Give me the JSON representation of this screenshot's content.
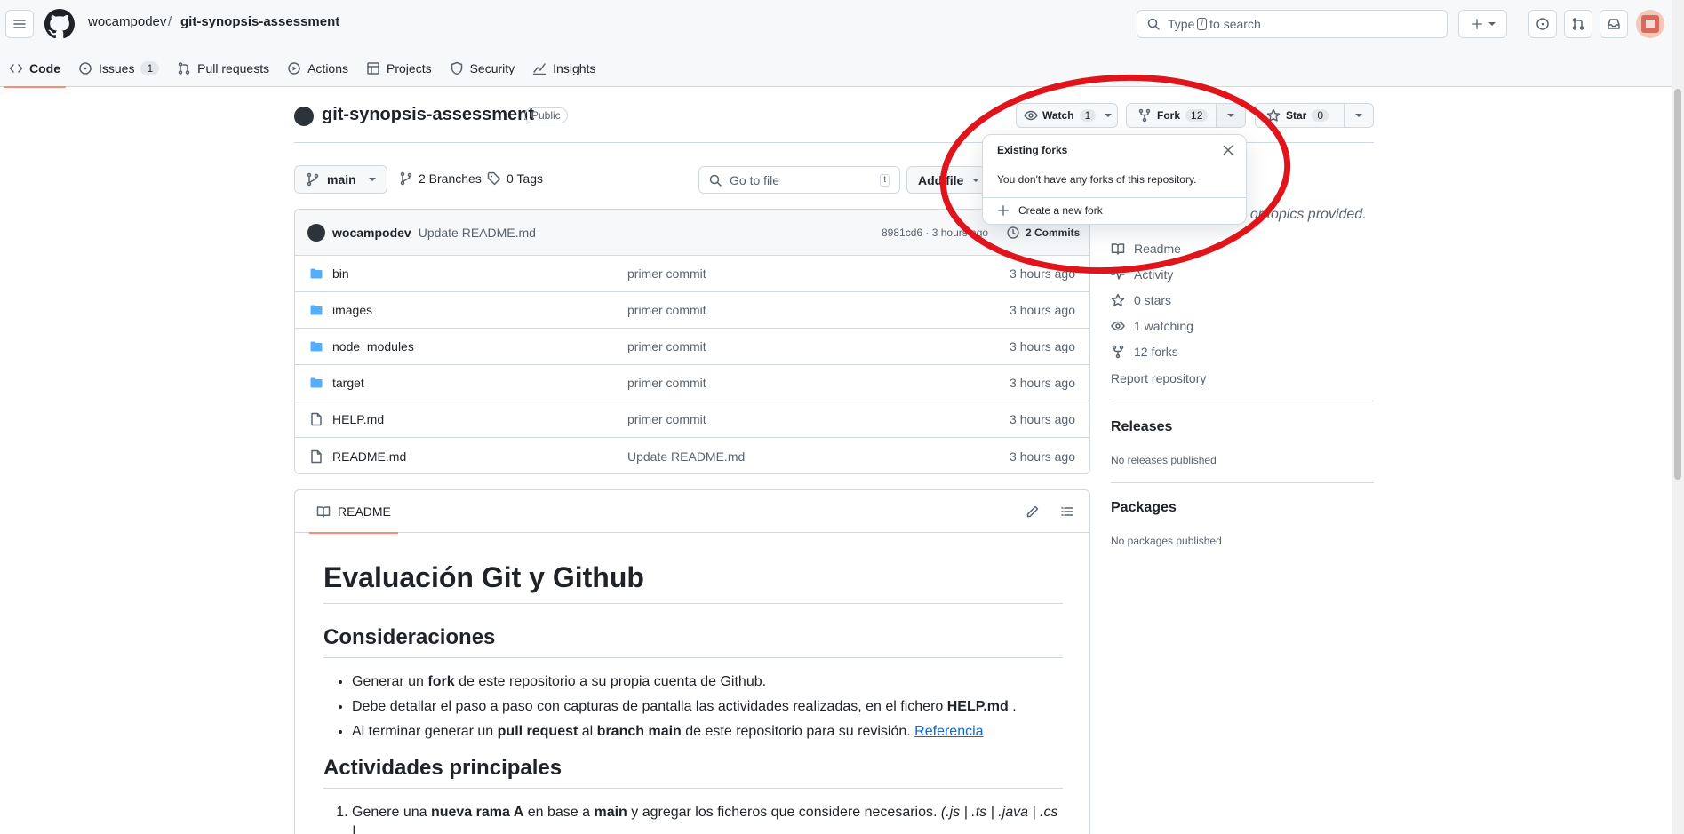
{
  "header": {
    "owner": "wocampodev",
    "separator": "/",
    "repo": "git-synopsis-assessment",
    "search": {
      "prefix": "Type",
      "key": "/",
      "suffix": "to search"
    }
  },
  "tabs": [
    {
      "label": "Code",
      "icon": "code-icon"
    },
    {
      "label": "Issues",
      "count": "1",
      "icon": "issue-icon"
    },
    {
      "label": "Pull requests",
      "icon": "pull-request-icon"
    },
    {
      "label": "Actions",
      "icon": "play-icon"
    },
    {
      "label": "Projects",
      "icon": "table-icon"
    },
    {
      "label": "Security",
      "icon": "shield-icon"
    },
    {
      "label": "Insights",
      "icon": "graph-icon"
    }
  ],
  "repo_header": {
    "name": "git-synopsis-assessment",
    "visibility": "Public",
    "watch": {
      "label": "Watch",
      "count": "1"
    },
    "fork": {
      "label": "Fork",
      "count": "12"
    },
    "star": {
      "label": "Star",
      "count": "0"
    }
  },
  "file_nav": {
    "branch": "main",
    "branches": "2 Branches",
    "tags": "0 Tags",
    "go_to_file": "Go to file",
    "go_to_file_key": "t",
    "add_file": "Add file"
  },
  "latest_commit": {
    "author": "wocampodev",
    "message": "Update README.md",
    "hash_time": "8981cd6 · 3 hours ago",
    "commits": "2 Commits"
  },
  "files": [
    {
      "name": "bin",
      "type": "folder",
      "message": "primer commit",
      "date": "3 hours ago"
    },
    {
      "name": "images",
      "type": "folder",
      "message": "primer commit",
      "date": "3 hours ago"
    },
    {
      "name": "node_modules",
      "type": "folder",
      "message": "primer commit",
      "date": "3 hours ago"
    },
    {
      "name": "target",
      "type": "folder",
      "message": "primer commit",
      "date": "3 hours ago"
    },
    {
      "name": "HELP.md",
      "type": "file",
      "message": "primer commit",
      "date": "3 hours ago"
    },
    {
      "name": "README.md",
      "type": "file",
      "message": "Update README.md",
      "date": "3 hours ago"
    }
  ],
  "readme": {
    "tab": "README",
    "h1": "Evaluación Git y Github",
    "h2_1": "Consideraciones",
    "bullets": [
      {
        "a": "Generar un ",
        "b": "fork",
        "c": " de este repositorio a su propia cuenta de Github."
      },
      {
        "a": "Debe detallar el paso a paso con capturas de pantalla las actividades realizadas, en el fichero ",
        "b": "HELP.md",
        "c": " ."
      },
      {
        "a": "Al terminar generar un ",
        "b": "pull request",
        "c": " al ",
        "d": "branch main",
        "e": " de este repositorio para su revisión. ",
        "link": "Referencia"
      }
    ],
    "h2_2": "Actividades principales",
    "step1": {
      "a": "Genere una ",
      "b": "nueva rama A",
      "c": " en base a ",
      "d": "main",
      "e": " y agregar los ficheros que considere necesarios. ",
      "f": "(.js | .ts | .java | .cs |"
    }
  },
  "sidebar": {
    "about_tail": ", or topics provided.",
    "items": [
      {
        "label": "Readme",
        "icon": "book-icon"
      },
      {
        "label": "Activity",
        "icon": "pulse-icon"
      },
      {
        "label": "0 stars",
        "icon": "star-icon"
      },
      {
        "label": "1 watching",
        "icon": "eye-icon"
      },
      {
        "label": "12 forks",
        "icon": "fork-icon"
      }
    ],
    "report": "Report repository",
    "releases_title": "Releases",
    "releases_empty": "No releases published",
    "packages_title": "Packages",
    "packages_empty": "No packages published"
  },
  "fork_dropdown": {
    "title": "Existing forks",
    "empty": "You don't have any forks of this repository.",
    "create": "Create a new fork"
  },
  "colors": {
    "accent_underline": "#fd8c73",
    "link": "#0969da",
    "folder": "#54aeff",
    "annotation_circle": "#e0141b"
  }
}
